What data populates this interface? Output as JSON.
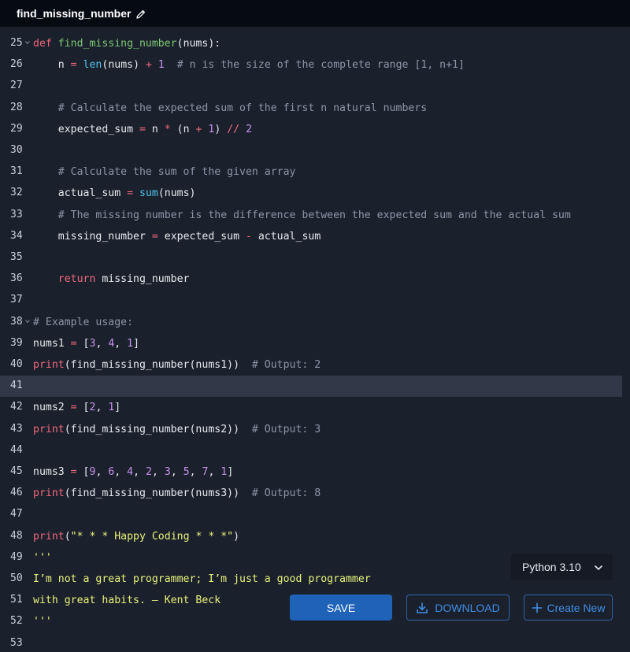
{
  "header": {
    "file_title": "find_missing_number"
  },
  "editor": {
    "lines": [
      {
        "n": "25",
        "fold": true,
        "active": false,
        "tokens": [
          [
            "kw",
            "def "
          ],
          [
            "fn",
            "find_missing_number"
          ],
          [
            "pl",
            "(nums):"
          ]
        ]
      },
      {
        "n": "26",
        "fold": false,
        "active": false,
        "tokens": [
          [
            "pl",
            "    n "
          ],
          [
            "op",
            "="
          ],
          [
            "pl",
            " "
          ],
          [
            "bi",
            "len"
          ],
          [
            "pl",
            "(nums) "
          ],
          [
            "op",
            "+"
          ],
          [
            "pl",
            " "
          ],
          [
            "num",
            "1"
          ],
          [
            "pl",
            "  "
          ],
          [
            "cm",
            "# n is the size of the complete range [1, n+1]"
          ]
        ]
      },
      {
        "n": "27",
        "fold": false,
        "active": false,
        "tokens": []
      },
      {
        "n": "28",
        "fold": false,
        "active": false,
        "tokens": [
          [
            "pl",
            "    "
          ],
          [
            "cm",
            "# Calculate the expected sum of the first n natural numbers"
          ]
        ]
      },
      {
        "n": "29",
        "fold": false,
        "active": false,
        "tokens": [
          [
            "pl",
            "    expected_sum "
          ],
          [
            "op",
            "="
          ],
          [
            "pl",
            " n "
          ],
          [
            "op",
            "*"
          ],
          [
            "pl",
            " (n "
          ],
          [
            "op",
            "+"
          ],
          [
            "pl",
            " "
          ],
          [
            "num",
            "1"
          ],
          [
            "pl",
            ") "
          ],
          [
            "op",
            "//"
          ],
          [
            "pl",
            " "
          ],
          [
            "num",
            "2"
          ]
        ]
      },
      {
        "n": "30",
        "fold": false,
        "active": false,
        "tokens": []
      },
      {
        "n": "31",
        "fold": false,
        "active": false,
        "tokens": [
          [
            "pl",
            "    "
          ],
          [
            "cm",
            "# Calculate the sum of the given array"
          ]
        ]
      },
      {
        "n": "32",
        "fold": false,
        "active": false,
        "tokens": [
          [
            "pl",
            "    actual_sum "
          ],
          [
            "op",
            "="
          ],
          [
            "pl",
            " "
          ],
          [
            "bi",
            "sum"
          ],
          [
            "pl",
            "(nums)"
          ]
        ]
      },
      {
        "n": "33",
        "fold": false,
        "active": false,
        "tokens": [
          [
            "pl",
            "    "
          ],
          [
            "cm",
            "# The missing number is the difference between the expected sum and the actual sum"
          ]
        ]
      },
      {
        "n": "34",
        "fold": false,
        "active": false,
        "tokens": [
          [
            "pl",
            "    missing_number "
          ],
          [
            "op",
            "="
          ],
          [
            "pl",
            " expected_sum "
          ],
          [
            "op",
            "-"
          ],
          [
            "pl",
            " actual_sum"
          ]
        ]
      },
      {
        "n": "35",
        "fold": false,
        "active": false,
        "tokens": []
      },
      {
        "n": "36",
        "fold": false,
        "active": false,
        "tokens": [
          [
            "pl",
            "    "
          ],
          [
            "kw",
            "return"
          ],
          [
            "pl",
            " missing_number"
          ]
        ]
      },
      {
        "n": "37",
        "fold": false,
        "active": false,
        "tokens": []
      },
      {
        "n": "38",
        "fold": true,
        "active": false,
        "tokens": [
          [
            "cm",
            "# Example usage:"
          ]
        ]
      },
      {
        "n": "39",
        "fold": false,
        "active": false,
        "tokens": [
          [
            "pl",
            "nums1 "
          ],
          [
            "op",
            "="
          ],
          [
            "pl",
            " ["
          ],
          [
            "num",
            "3"
          ],
          [
            "pl",
            ", "
          ],
          [
            "num",
            "4"
          ],
          [
            "pl",
            ", "
          ],
          [
            "num",
            "1"
          ],
          [
            "pl",
            "]"
          ]
        ]
      },
      {
        "n": "40",
        "fold": false,
        "active": false,
        "tokens": [
          [
            "kw",
            "print"
          ],
          [
            "pl",
            "(find_missing_number(nums1))  "
          ],
          [
            "cm",
            "# Output: 2"
          ]
        ]
      },
      {
        "n": "41",
        "fold": false,
        "active": true,
        "tokens": []
      },
      {
        "n": "42",
        "fold": false,
        "active": false,
        "tokens": [
          [
            "pl",
            "nums2 "
          ],
          [
            "op",
            "="
          ],
          [
            "pl",
            " ["
          ],
          [
            "num",
            "2"
          ],
          [
            "pl",
            ", "
          ],
          [
            "num",
            "1"
          ],
          [
            "pl",
            "]"
          ]
        ]
      },
      {
        "n": "43",
        "fold": false,
        "active": false,
        "tokens": [
          [
            "kw",
            "print"
          ],
          [
            "pl",
            "(find_missing_number(nums2))  "
          ],
          [
            "cm",
            "# Output: 3"
          ]
        ]
      },
      {
        "n": "44",
        "fold": false,
        "active": false,
        "tokens": []
      },
      {
        "n": "45",
        "fold": false,
        "active": false,
        "tokens": [
          [
            "pl",
            "nums3 "
          ],
          [
            "op",
            "="
          ],
          [
            "pl",
            " ["
          ],
          [
            "num",
            "9"
          ],
          [
            "pl",
            ", "
          ],
          [
            "num",
            "6"
          ],
          [
            "pl",
            ", "
          ],
          [
            "num",
            "4"
          ],
          [
            "pl",
            ", "
          ],
          [
            "num",
            "2"
          ],
          [
            "pl",
            ", "
          ],
          [
            "num",
            "3"
          ],
          [
            "pl",
            ", "
          ],
          [
            "num",
            "5"
          ],
          [
            "pl",
            ", "
          ],
          [
            "num",
            "7"
          ],
          [
            "pl",
            ", "
          ],
          [
            "num",
            "1"
          ],
          [
            "pl",
            "]"
          ]
        ]
      },
      {
        "n": "46",
        "fold": false,
        "active": false,
        "tokens": [
          [
            "kw",
            "print"
          ],
          [
            "pl",
            "(find_missing_number(nums3))  "
          ],
          [
            "cm",
            "# Output: 8"
          ]
        ]
      },
      {
        "n": "47",
        "fold": false,
        "active": false,
        "tokens": []
      },
      {
        "n": "48",
        "fold": false,
        "active": false,
        "tokens": [
          [
            "kw",
            "print"
          ],
          [
            "pl",
            "("
          ],
          [
            "str",
            "\"* * * Happy Coding * * *\""
          ],
          [
            "pl",
            ")"
          ]
        ]
      },
      {
        "n": "49",
        "fold": false,
        "active": false,
        "tokens": [
          [
            "str",
            "'''"
          ]
        ]
      },
      {
        "n": "50",
        "fold": false,
        "active": false,
        "tokens": [
          [
            "str",
            "I’m not a great programmer; I’m just a good programmer"
          ]
        ]
      },
      {
        "n": "51",
        "fold": false,
        "active": false,
        "tokens": [
          [
            "str",
            "with great habits. — Kent Beck"
          ]
        ]
      },
      {
        "n": "52",
        "fold": false,
        "active": false,
        "tokens": [
          [
            "str",
            "'''"
          ]
        ]
      },
      {
        "n": "53",
        "fold": false,
        "active": false,
        "tokens": []
      }
    ]
  },
  "controls": {
    "language_version": "Python 3.10",
    "save_label": "SAVE",
    "download_label": "DOWNLOAD",
    "create_new_label": "Create New"
  },
  "icons": {
    "pencil": "pencil-icon",
    "chevron": "chevron-down-icon",
    "download": "download-icon",
    "plus": "plus-icon",
    "fold": "fold-arrow-icon"
  },
  "colors": {
    "background": "#1b212c",
    "header": "#060a13",
    "active_line": "#323847",
    "accent": "#1e63b8",
    "keyword": "#f0677d",
    "function": "#7ec974",
    "number": "#c792ea",
    "comment": "#8c95a8",
    "string": "#e9f27a",
    "builtin": "#4fc3e8"
  }
}
